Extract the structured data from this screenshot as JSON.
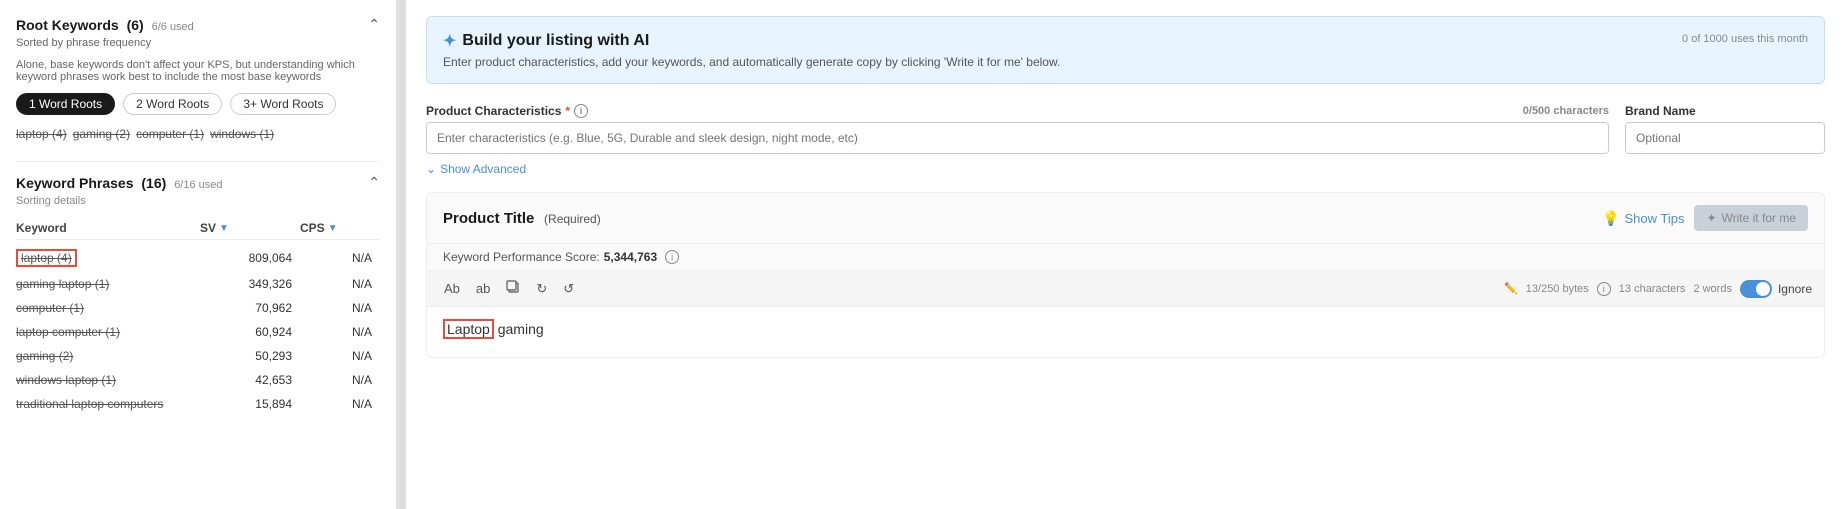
{
  "left": {
    "root_keywords": {
      "title": "Root Keywords",
      "count": "(6)",
      "used": "6/6 used",
      "subtitle": "Sorted by phrase frequency",
      "description": "Alone, base keywords don't affect your KPS, but understanding which keyword phrases work best to include the most base keywords",
      "filters": [
        {
          "label": "1 Word Roots",
          "active": true
        },
        {
          "label": "2 Word Roots",
          "active": false
        },
        {
          "label": "3+ Word Roots",
          "active": false
        }
      ],
      "tags": [
        {
          "text": "laptop (4)"
        },
        {
          "text": "gaming (2)"
        },
        {
          "text": "computer (1)"
        },
        {
          "text": "windows (1)"
        }
      ]
    },
    "keyword_phrases": {
      "title": "Keyword Phrases",
      "count": "(16)",
      "used": "6/16 used",
      "sorting": "Sorting details",
      "columns": [
        {
          "label": "Keyword"
        },
        {
          "label": "SV",
          "sortable": true
        },
        {
          "label": "CPS",
          "sortable": true
        }
      ],
      "rows": [
        {
          "keyword": "laptop (4)",
          "sv": "809,064",
          "cps": "N/A",
          "highlighted": true,
          "boxed": true
        },
        {
          "keyword": "gaming laptop (1)",
          "sv": "349,326",
          "cps": "N/A",
          "highlighted": false
        },
        {
          "keyword": "computer (1)",
          "sv": "70,962",
          "cps": "N/A",
          "highlighted": false
        },
        {
          "keyword": "laptop computer (1)",
          "sv": "60,924",
          "cps": "N/A",
          "highlighted": false
        },
        {
          "keyword": "gaming (2)",
          "sv": "50,293",
          "cps": "N/A",
          "highlighted": false
        },
        {
          "keyword": "windows laptop (1)",
          "sv": "42,653",
          "cps": "N/A",
          "highlighted": false
        },
        {
          "keyword": "traditional laptop computers",
          "sv": "15,894",
          "cps": "N/A",
          "highlighted": false
        }
      ]
    }
  },
  "right": {
    "ai_banner": {
      "icon": "✦",
      "title": "Build your listing with AI",
      "description": "Enter product characteristics, add your keywords, and automatically generate copy by clicking 'Write it for me' below.",
      "usage": "0 of 1000 uses this month"
    },
    "characteristics": {
      "label": "Product Characteristics",
      "asterisk": "*",
      "char_count": "0/500 characters",
      "placeholder": "Enter characteristics (e.g. Blue, 5G, Durable and sleek design, night mode, etc)",
      "brand_label": "Brand Name",
      "brand_placeholder": "Optional",
      "show_advanced": "Show Advanced"
    },
    "product_title": {
      "label": "Product Title",
      "required": "(Required)",
      "kps_label": "Keyword Performance Score:",
      "kps_value": "5,344,763",
      "show_tips": "Show Tips",
      "write_it": "Write it for me",
      "bytes_info": "13/250 bytes",
      "chars_info": "13 characters",
      "words_info": "2 words",
      "ignore_label": "Ignore",
      "editor_content": "Laptop gaming",
      "highlighted_word": "Laptop"
    }
  }
}
